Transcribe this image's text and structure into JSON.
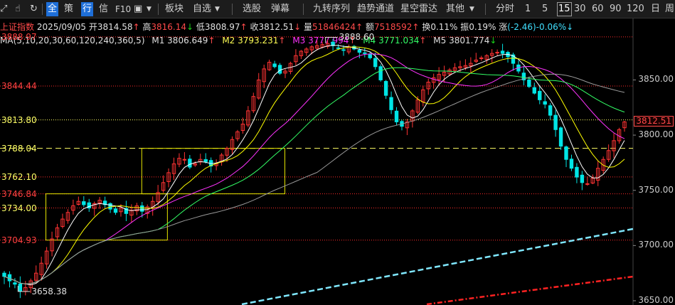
{
  "toolbar": {
    "all_label": "全",
    "strategy_label": "策",
    "row_label": "行",
    "info_label": "信",
    "f10_label": "F10",
    "sector_label": "板块",
    "watchlist_label": "自选",
    "stock_pick_label": "选股",
    "barrage_label": "弹幕",
    "nine_turn_label": "九转序列",
    "trend_channel_label": "趋势通道",
    "star_radar_label": "星空雷达",
    "other_label": "其他",
    "periods": [
      "分时",
      "1",
      "5",
      "15",
      "30",
      "60",
      "90",
      "120",
      "日",
      "周"
    ],
    "selected_period": "15"
  },
  "quote": {
    "name": "上证指数",
    "date": "2025/09/05",
    "open_label": "开",
    "open": "3814.58",
    "open_arrow": "↑",
    "high_label": "高",
    "high": "3816.14",
    "high_arrow": "↓",
    "low_label": "低",
    "low": "3808.97",
    "low_arrow": "↑",
    "close_label": "收",
    "close": "3812.51",
    "close_arrow": "↓",
    "volume_label": "量",
    "volume": "51846424",
    "volume_arrow": "↑",
    "amount_label": "额",
    "amount": "7518592",
    "amount_arrow": "↑",
    "turnover_label": "换",
    "turnover": "0.11%",
    "amplitude_label": "振",
    "amplitude": "0.19%",
    "change_label": "涨",
    "change": "(-2.46)-0.06%",
    "change_arrow": "↓"
  },
  "ma": {
    "title": "MA(5,10,20,30,60,120,240,360,5)",
    "m1_label": "M1",
    "m1": "3806.649",
    "m1_arrow": "↑",
    "m2_label": "M2",
    "m2": "3793.231",
    "m2_arrow": "↑",
    "m3_label": "M3",
    "m3": "3777.994",
    "m3_arrow": "↑",
    "m4_label": "M4",
    "m4": "3771.034",
    "m4_arrow": "↑",
    "m5_label": "M5",
    "m5": "3801.774",
    "m5_arrow": "↓"
  },
  "colors": {
    "up": "#ff3333",
    "down": "#00e5e5",
    "m1": "#ffffff",
    "m2": "#ffff00",
    "m3": "#ff33ff",
    "m4": "#33ff66",
    "m5": "#999999",
    "level": "#ff2a2a",
    "current": "#ffff66",
    "box": "#e6e600",
    "trend_cyan": "#80e8ff",
    "trend_red": "#ff2222"
  },
  "chart_data": {
    "type": "candlestick",
    "ylim": [
      3650,
      3905
    ],
    "y_ticks": [
      "3850.00",
      "3800.00",
      "3750.00",
      "3700.00",
      "3650.00"
    ],
    "levels": [
      "3888.97",
      "3844.44",
      "3813.80",
      "3788.04",
      "3762.10",
      "3746.84",
      "3734.00",
      "3704.93"
    ],
    "current_price": "3812.51",
    "extremes": {
      "high": "3888.60",
      "low": "3658.38"
    },
    "boxes": [
      {
        "x_start": 0.068,
        "x_end": 0.248,
        "y_high": 3746.84,
        "y_low": 3704.93
      },
      {
        "x_start": 0.21,
        "x_end": 0.422,
        "y_high": 3788.04,
        "y_low": 3746.84
      }
    ],
    "closes": [
      3672,
      3668,
      3665,
      3659,
      3662,
      3668,
      3675,
      3684,
      3695,
      3706,
      3716,
      3724,
      3730,
      3736,
      3740,
      3737,
      3734,
      3738,
      3741,
      3737,
      3733,
      3730,
      3734,
      3729,
      3732,
      3736,
      3731,
      3735,
      3740,
      3748,
      3757,
      3766,
      3774,
      3779,
      3778,
      3771,
      3774,
      3778,
      3776,
      3772,
      3774,
      3782,
      3788,
      3796,
      3803,
      3810,
      3822,
      3835,
      3850,
      3860,
      3866,
      3862,
      3856,
      3858,
      3865,
      3872,
      3876,
      3878,
      3880,
      3881,
      3882,
      3883,
      3881,
      3879,
      3877,
      3880,
      3878,
      3875,
      3874,
      3870,
      3862,
      3850,
      3836,
      3823,
      3812,
      3808,
      3812,
      3822,
      3832,
      3841,
      3848,
      3852,
      3855,
      3857,
      3859,
      3861,
      3862,
      3863,
      3865,
      3868,
      3870,
      3872,
      3874,
      3875,
      3874,
      3871,
      3865,
      3858,
      3850,
      3844,
      3838,
      3832,
      3828,
      3818,
      3805,
      3790,
      3778,
      3770,
      3762,
      3757,
      3756,
      3761,
      3770,
      3778,
      3786,
      3795,
      3805,
      3812
    ]
  }
}
